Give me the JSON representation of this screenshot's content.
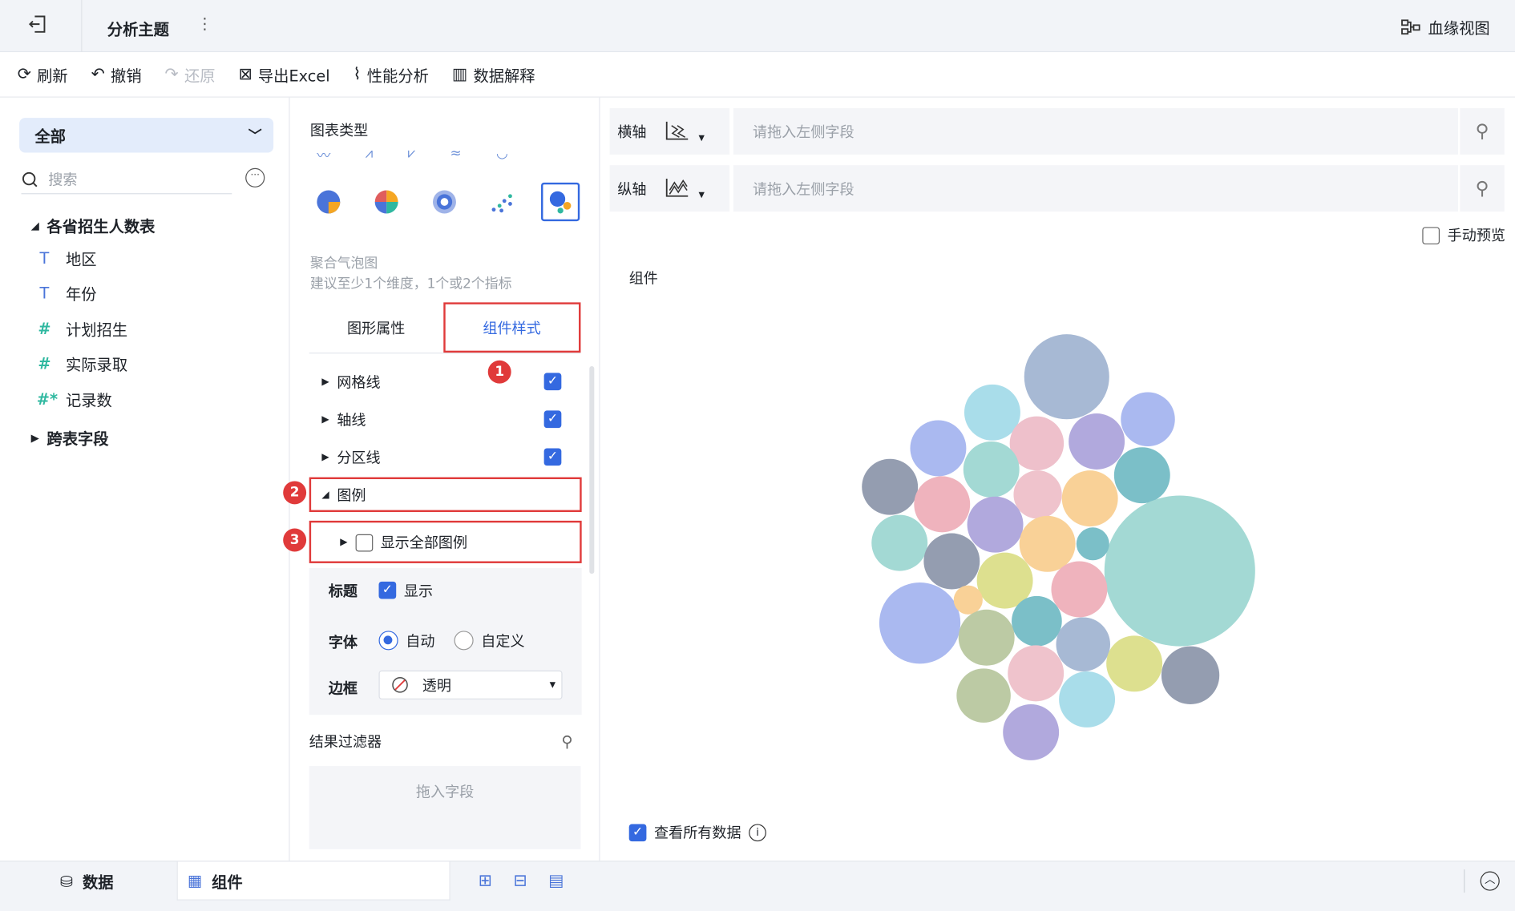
{
  "header": {
    "title": "分析主题",
    "more": "⋮",
    "lineage_label": "血缘视图"
  },
  "toolbar": {
    "refresh": "刷新",
    "undo": "撤销",
    "redo": "还原",
    "export": "导出Excel",
    "perf": "性能分析",
    "explain": "数据解释"
  },
  "left": {
    "select_value": "全部",
    "search_placeholder": "搜索",
    "table_name": "各省招生人数表",
    "fields": [
      {
        "type": "T",
        "label": "地区"
      },
      {
        "type": "T",
        "label": "年份"
      },
      {
        "type": "#",
        "label": "计划招生"
      },
      {
        "type": "#",
        "label": "实际录取"
      },
      {
        "type": "#*",
        "label": "记录数"
      }
    ],
    "cross_table": "跨表字段"
  },
  "middle": {
    "chart_type_label": "图表类型",
    "chart_desc_name": "聚合气泡图",
    "chart_desc_hint": "建议至少1个维度，1个或2个指标",
    "tab_shape": "图形属性",
    "tab_style": "组件样式",
    "props": [
      "网格线",
      "轴线",
      "分区线"
    ],
    "legend": "图例",
    "show_all_legend": "显示全部图例",
    "title_label": "标题",
    "title_show": "显示",
    "font_label": "字体",
    "font_auto": "自动",
    "font_custom": "自定义",
    "border_label": "边框",
    "border_value": "透明",
    "filter_title": "结果过滤器",
    "filter_drop": "拖入字段",
    "badges": [
      "1",
      "2",
      "3"
    ]
  },
  "right": {
    "x_axis": "横轴",
    "y_axis": "纵轴",
    "drop_placeholder": "请拖入左侧字段",
    "manual_preview": "手动预览",
    "component_title": "组件",
    "view_all": "查看所有数据"
  },
  "bottom": {
    "data_tab": "数据",
    "component_tab": "组件"
  },
  "colors": {
    "accent": "#3469e0",
    "annotation": "#e03a3a"
  }
}
